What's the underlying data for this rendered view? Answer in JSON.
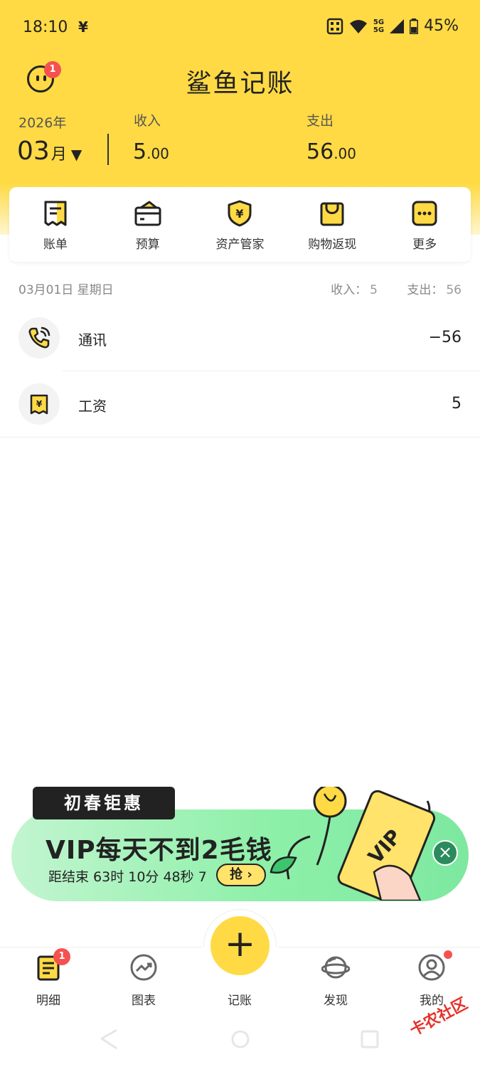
{
  "status_bar": {
    "time": "18:10",
    "yen_icon": "¥",
    "battery": "45%",
    "signal_label": "5G"
  },
  "header": {
    "title": "鲨鱼记账",
    "avatar_badge": "1",
    "year": "2026年",
    "month": "03",
    "month_suffix": "月",
    "income_label": "收入",
    "income_int": "5",
    "income_dec": ".00",
    "expense_label": "支出",
    "expense_int": "56",
    "expense_dec": ".00"
  },
  "quick_actions": [
    {
      "label": "账单",
      "icon": "bill-icon"
    },
    {
      "label": "预算",
      "icon": "budget-icon"
    },
    {
      "label": "资产管家",
      "icon": "asset-shield-icon"
    },
    {
      "label": "购物返现",
      "icon": "shopping-bag-icon"
    },
    {
      "label": "更多",
      "icon": "more-icon"
    }
  ],
  "day_group": {
    "date": "03月01日 星期日",
    "income_label": "收入：",
    "income_value": "5",
    "expense_label": "支出：",
    "expense_value": "56"
  },
  "transactions": [
    {
      "name": "通讯",
      "amount": "−56",
      "icon": "phone-icon"
    },
    {
      "name": "工资",
      "amount": "5",
      "icon": "salary-icon"
    }
  ],
  "promo": {
    "tag": "初春钜惠",
    "headline": "VIP每天不到2毛钱",
    "countdown": "距结束 63时 10分 48秒 7",
    "button": "抢 ›",
    "card_text": "VIP",
    "close": "×"
  },
  "bottom_nav": [
    {
      "label": "明细",
      "icon": "detail-icon",
      "badge": "1"
    },
    {
      "label": "图表",
      "icon": "chart-icon"
    },
    {
      "label": "记账",
      "icon": "plus-icon"
    },
    {
      "label": "发现",
      "icon": "planet-icon"
    },
    {
      "label": "我的",
      "icon": "profile-icon"
    }
  ],
  "fab_symbol": "+",
  "watermark": "卡农社区",
  "colors": {
    "brand_yellow": "#FFDA44",
    "badge_red": "#F55151",
    "promo_green": "#8EF0A9"
  }
}
